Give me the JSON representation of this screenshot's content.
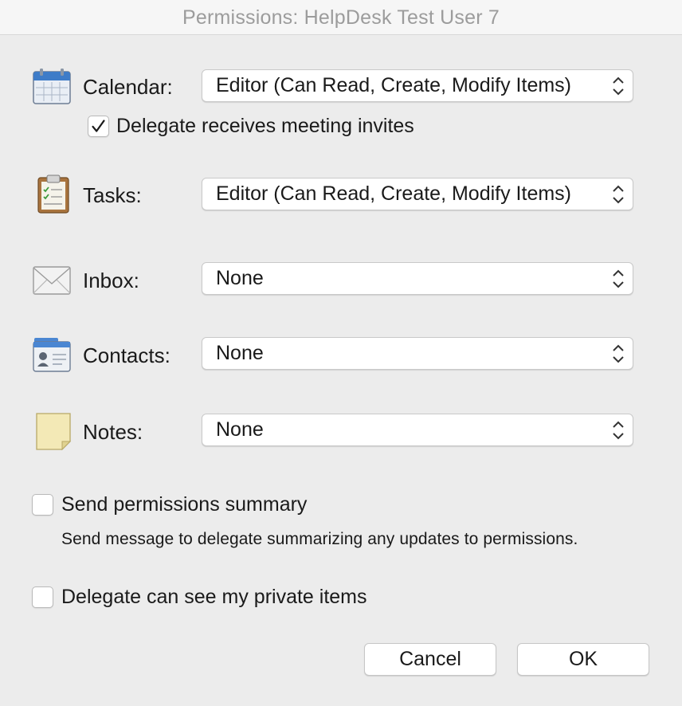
{
  "window": {
    "title": "Permissions: HelpDesk Test User 7"
  },
  "permissions": [
    {
      "key": "calendar",
      "label": "Calendar:",
      "icon": "calendar-icon",
      "value": "Editor (Can Read, Create, Modify Items)"
    },
    {
      "key": "tasks",
      "label": "Tasks:",
      "icon": "clipboard-icon",
      "value": "Editor (Can Read, Create, Modify Items)"
    },
    {
      "key": "inbox",
      "label": "Inbox:",
      "icon": "envelope-icon",
      "value": "None"
    },
    {
      "key": "contacts",
      "label": "Contacts:",
      "icon": "contacts-card-icon",
      "value": "None"
    },
    {
      "key": "notes",
      "label": "Notes:",
      "icon": "sticky-note-icon",
      "value": "None"
    }
  ],
  "calendar_options": {
    "delegate_invites_label": "Delegate receives meeting invites",
    "delegate_invites_checked": true
  },
  "summary": {
    "label": "Send permissions summary",
    "checked": false,
    "hint": "Send message to delegate summarizing any updates to permissions."
  },
  "private_items": {
    "label": "Delegate can see my private items",
    "checked": false
  },
  "buttons": {
    "cancel": "Cancel",
    "ok": "OK"
  }
}
